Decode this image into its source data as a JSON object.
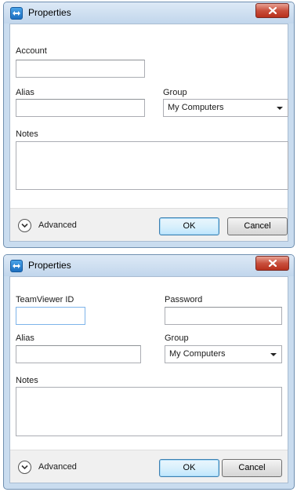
{
  "dialog1": {
    "title": "Properties",
    "fields": {
      "account_label": "Account",
      "account_value": "",
      "alias_label": "Alias",
      "alias_value": "",
      "group_label": "Group",
      "group_value": "My Computers",
      "notes_label": "Notes",
      "notes_value": ""
    },
    "footer": {
      "advanced_label": "Advanced",
      "ok_label": "OK",
      "cancel_label": "Cancel"
    }
  },
  "dialog2": {
    "title": "Properties",
    "fields": {
      "teamviewer_id_label": "TeamViewer ID",
      "teamviewer_id_value": "",
      "password_label": "Password",
      "password_value": "",
      "alias_label": "Alias",
      "alias_value": "",
      "group_label": "Group",
      "group_value": "My Computers",
      "notes_label": "Notes",
      "notes_value": ""
    },
    "footer": {
      "advanced_label": "Advanced",
      "ok_label": "OK",
      "cancel_label": "Cancel"
    }
  },
  "icons": {
    "app": "teamviewer-app-icon",
    "close": "close-icon",
    "advanced": "chevron-down-circle-icon",
    "dropdown": "dropdown-arrow-icon"
  },
  "colors": {
    "frame": "#c9dcef",
    "close_button": "#c9503d",
    "ok_button_border": "#3c7fb1",
    "focus_border": "#7eb4ea"
  }
}
